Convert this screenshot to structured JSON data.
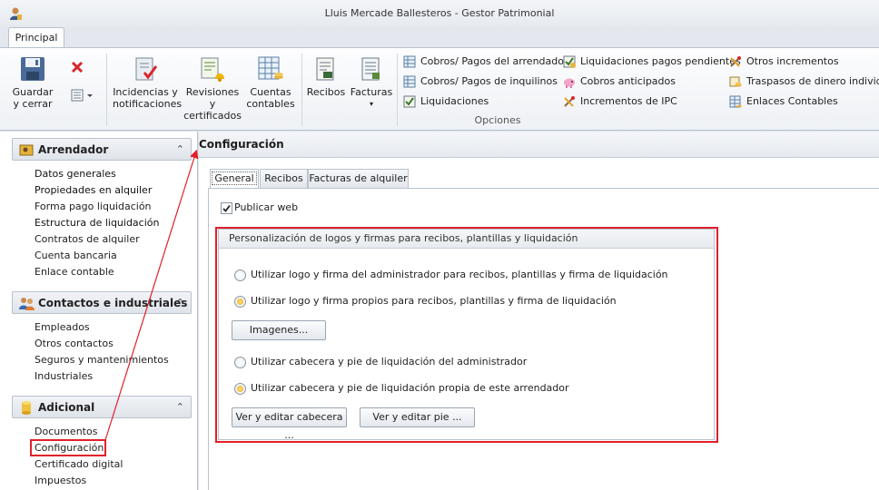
{
  "window": {
    "title": "Lluis Mercade Ballesteros - Gestor Patrimonial"
  },
  "ribbon": {
    "tab": "Principal",
    "buttons": {
      "guardar": "Guardar\ny cerrar",
      "incidencias": "Incidencias y\nnotificaciones",
      "revisiones": "Revisiones y\ncertificados",
      "cuentas": "Cuentas\ncontables",
      "recibos": "Recibos",
      "facturas": "Facturas"
    },
    "small_items": {
      "col1": [
        "Cobros/ Pagos del arrendador",
        "Cobros/ Pagos de inquilinos",
        "Liquidaciones"
      ],
      "col2": [
        "Liquidaciones pagos pendientes",
        "Cobros anticipados",
        "Incrementos de IPC"
      ],
      "col3": [
        "Otros incrementos",
        "Traspasos de dinero individual",
        "Enlaces Contables"
      ]
    },
    "group_label": "Opciones"
  },
  "sidebar": {
    "sections": [
      {
        "title": "Arrendador",
        "items": [
          "Datos generales",
          "Propiedades en alquiler",
          "Forma pago liquidación",
          "Estructura de liquidación",
          "Contratos de alquiler",
          "Cuenta bancaria",
          "Enlace contable"
        ]
      },
      {
        "title": "Contactos e industriales",
        "items": [
          "Empleados",
          "Otros contactos",
          "Seguros y mantenimientos",
          "Industriales"
        ]
      },
      {
        "title": "Adicional",
        "items": [
          "Documentos",
          "Configuración",
          "Certificado digital",
          "Impuestos"
        ]
      }
    ]
  },
  "main": {
    "title": "Configuración",
    "tabs": [
      "General",
      "Recibos",
      "Facturas de alquiler"
    ],
    "publicar_web": "Publicar web",
    "group_title": "Personalización de logos y firmas para recibos, plantillas y liquidación",
    "radios": [
      "Utilizar logo y firma del administrador para recibos, plantillas y firma de liquidación",
      "Utilizar logo y firma propios para recibos, plantillas y firma de liquidación",
      "Utilizar cabecera y pie de liquidación del administrador",
      "Utilizar cabecera y pie de liquidación propia de este arrendador"
    ],
    "buttons": {
      "imagenes": "Imagenes...",
      "ver_cabecera": "Ver y editar cabecera ...",
      "ver_pie": "Ver y editar pie ..."
    }
  },
  "colors": {
    "highlight": "#e0202a",
    "radio_selected": "#f0a500"
  }
}
